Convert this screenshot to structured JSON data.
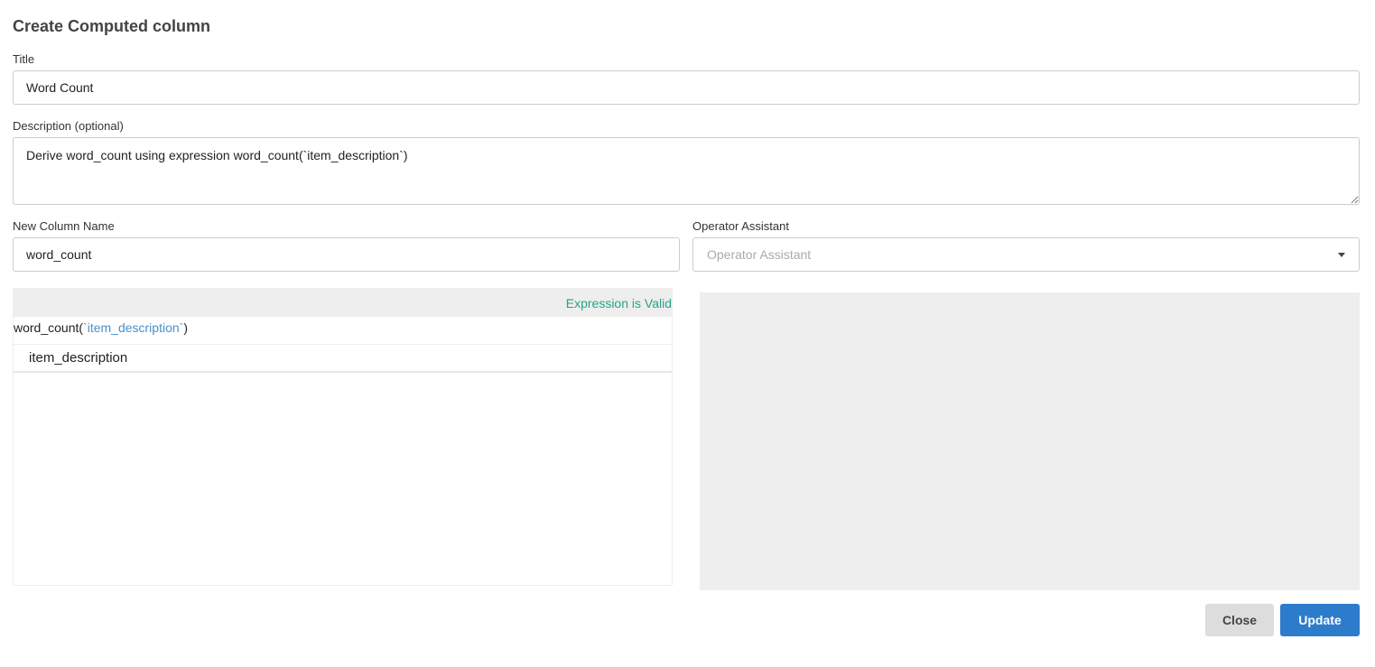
{
  "dialog": {
    "title": "Create Computed column"
  },
  "title_field": {
    "label": "Title",
    "value": "Word Count"
  },
  "description_field": {
    "label": "Description (optional)",
    "value": "Derive word_count using expression word_count(`item_description`)"
  },
  "column_name_field": {
    "label": "New Column Name",
    "value": "word_count"
  },
  "operator_assistant": {
    "label": "Operator Assistant",
    "placeholder": "Operator Assistant",
    "icon": "chevron-down-icon"
  },
  "editor": {
    "status": "Expression is Valid",
    "status_color": "#26a387",
    "expression_prefix": "word_count(",
    "expression_token": "`item_description`",
    "expression_suffix": ")",
    "token_color": "#4a90c8",
    "suggestions": [
      {
        "label": "item_description"
      }
    ]
  },
  "footer": {
    "close_label": "Close",
    "update_label": "Update",
    "update_color": "#2d7ccc"
  }
}
